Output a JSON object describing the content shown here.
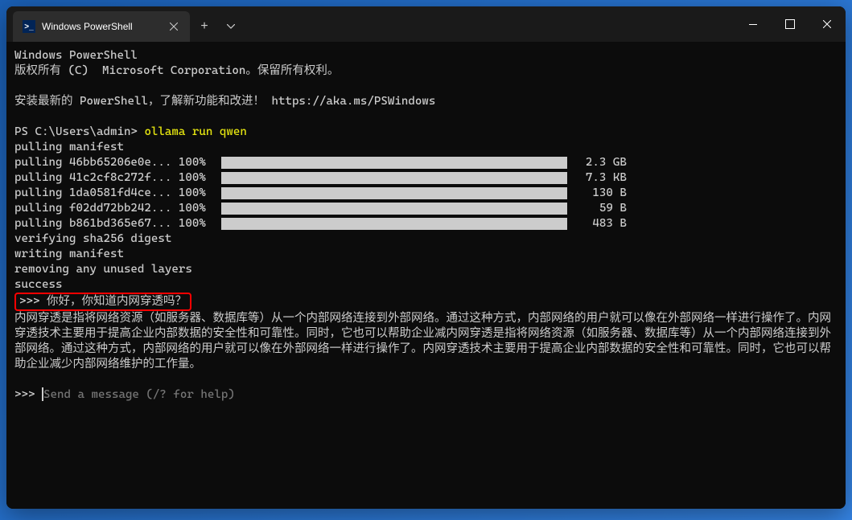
{
  "window": {
    "tab_title": "Windows PowerShell"
  },
  "terminal": {
    "header1": "Windows PowerShell",
    "header2": "版权所有 (C)  Microsoft Corporation。保留所有权利。",
    "install_msg": "安装最新的 PowerShell，了解新功能和改进！ https://aka.ms/PSWindows",
    "prompt_path": "PS C:\\Users\\admin> ",
    "command": "ollama run qwen",
    "pull_manifest": "pulling manifest",
    "pulls": [
      {
        "hash": "pulling 46bb65206e0e... 100%  ",
        "size": "2.3 GB"
      },
      {
        "hash": "pulling 41c2cf8c272f... 100%  ",
        "size": "7.3 KB"
      },
      {
        "hash": "pulling 1da0581fd4ce... 100%  ",
        "size": " 130 B"
      },
      {
        "hash": "pulling f02dd72bb242... 100%  ",
        "size": "  59 B"
      },
      {
        "hash": "pulling b861bd365e67... 100%  ",
        "size": " 483 B"
      }
    ],
    "verify": "verifying sha256 digest",
    "writing": "writing manifest",
    "removing": "removing any unused layers",
    "success": "success",
    "user_prompt_prefix": ">>> ",
    "user_question": "你好，你知道内网穿透吗？",
    "response": "内网穿透是指将网络资源（如服务器、数据库等）从一个内部网络连接到外部网络。通过这种方式，内部网络的用户就可以像在外部网络一样进行操作了。内网穿透技术主要用于提高企业内部数据的安全性和可靠性。同时，它也可以帮助企业减内网穿透是指将网络资源（如服务器、数据库等）从一个内部网络连接到外部网络。通过这种方式，内部网络的用户就可以像在外部网络一样进行操作了。内网穿透技术主要用于提高企业内部数据的安全性和可靠性。同时，它也可以帮助企业减少内部网络维护的工作量。",
    "input_prefix": ">>> ",
    "input_placeholder": "Send a message (/? for help)"
  }
}
